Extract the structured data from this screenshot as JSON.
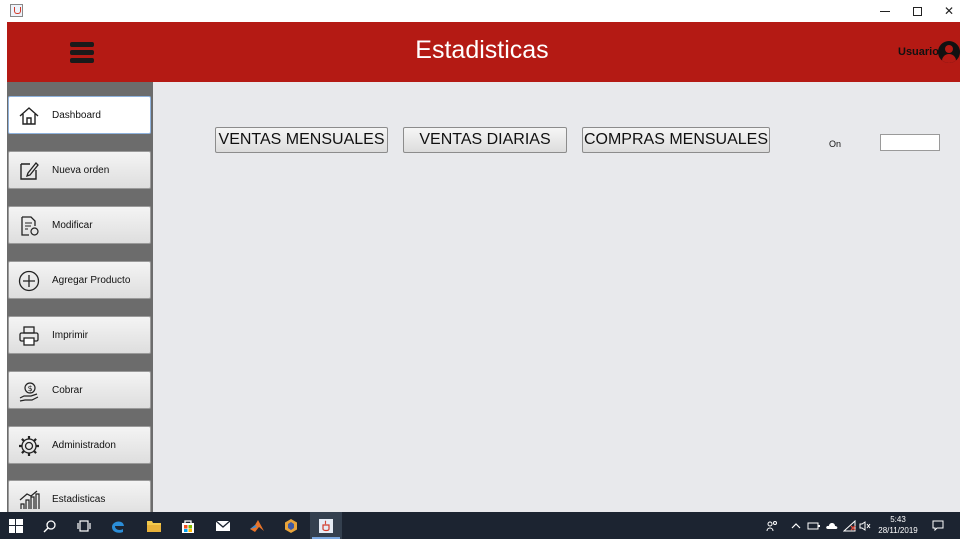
{
  "window": {
    "title_icon": "java-icon",
    "controls": [
      "minimize-icon",
      "maximize-icon",
      "close-icon"
    ]
  },
  "header": {
    "title": "Estadisticas",
    "user_label": "Usuario",
    "background_color": "#b41a14"
  },
  "sidebar": {
    "items": [
      {
        "label": "Dashboard",
        "icon": "home-icon",
        "active": true
      },
      {
        "label": "Nueva orden",
        "icon": "edit-icon",
        "active": false
      },
      {
        "label": "Modificar",
        "icon": "document-refresh-icon",
        "active": false
      },
      {
        "label": "Agregar Producto",
        "icon": "plus-circle-icon",
        "active": false
      },
      {
        "label": "Imprimir",
        "icon": "printer-icon",
        "active": false
      },
      {
        "label": "Cobrar",
        "icon": "money-hand-icon",
        "active": false
      },
      {
        "label": "Administradon",
        "icon": "gear-icon",
        "active": false
      },
      {
        "label": "Estadisticas",
        "icon": "chart-icon",
        "active": false
      }
    ]
  },
  "main": {
    "buttons": {
      "ventas_mensuales": "VENTAS MENSUALES",
      "ventas_diarias": "VENTAS DIARIAS",
      "compras_mensuales": "COMPRAS MENSUALES"
    },
    "on_label": "On",
    "on_value": ""
  },
  "taskbar": {
    "apps": [
      "windows-start-icon",
      "search-icon",
      "task-view-icon",
      "edge-icon",
      "file-explorer-icon",
      "store-icon",
      "mail-icon",
      "matlab-icon",
      "app-hexagon-icon",
      "java-icon"
    ],
    "clock_time": "5:43",
    "clock_date": "28/11/2019"
  }
}
